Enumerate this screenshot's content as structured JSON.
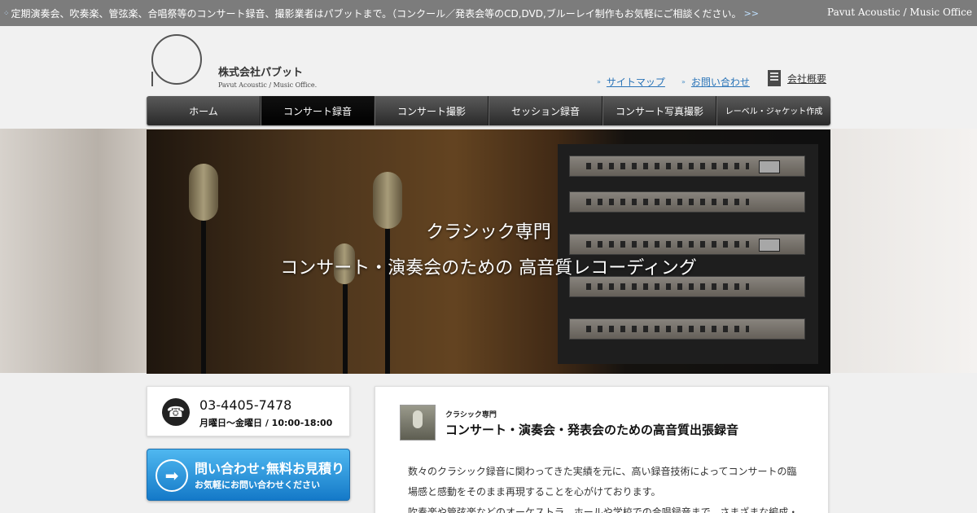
{
  "topbar": {
    "announcement": "定期演奏会、吹奏楽、管弦楽、合唱祭等のコンサート録音、撮影業者はパブットまで。（コンクール／発表会等のCD,DVD,ブルーレイ制作もお気軽にご相談ください。",
    "more": ">>",
    "brand": "Pavut Acoustic / Music Office"
  },
  "logo": {
    "name": "株式会社パブット",
    "sub": "Pavut Acoustic / Music Office."
  },
  "utility": {
    "sitemap": "サイトマップ",
    "contact": "お問い合わせ",
    "company": "会社概要"
  },
  "nav": [
    {
      "label": "ホーム"
    },
    {
      "label": "コンサート録音"
    },
    {
      "label": "コンサート撮影"
    },
    {
      "label": "セッション録音"
    },
    {
      "label": "コンサート写真撮影"
    },
    {
      "label": "レーベル・ジャケット作成"
    }
  ],
  "nav_active": "コンサート録音",
  "hero": {
    "line1": "クラシック専門",
    "line2": "コンサート・演奏会のための 高音質レコーディング"
  },
  "sidebar": {
    "tel_number": "03-4405-7478",
    "tel_hours": "月曜日〜金曜日 / 10:00-18:00",
    "cta_title": "問い合わせ･無料お見積り",
    "cta_sub": "お気軽にお問い合わせください"
  },
  "main": {
    "kicker": "クラシック専門",
    "title": "コンサート・演奏会・発表会のための高音質出張録音",
    "body1": "数々のクラシック録音に関わってきた実績を元に、高い録音技術によってコンサートの臨",
    "body2": "場感と感動をそのまま再現することを心がけております。",
    "body3": "吹奏楽や管弦楽などのオーケストラ、ホールや学校での合唱録音まで、さまざまな編成・"
  },
  "icons": {
    "phone": "phone-icon",
    "arrow": "arrow-right-circle-icon",
    "building": "building-icon",
    "mic": "microphone-icon"
  }
}
